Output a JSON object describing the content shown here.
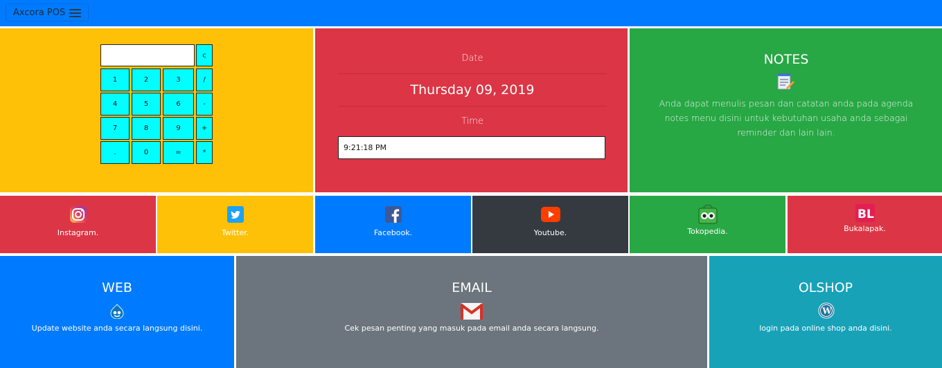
{
  "navbar": {
    "brand": "Axcora POS"
  },
  "calculator": {
    "display_value": "",
    "keys": [
      "c",
      "1",
      "2",
      "3",
      "/",
      "4",
      "5",
      "6",
      "-",
      "7",
      "8",
      "9",
      "+",
      ".",
      "0",
      "=",
      "*"
    ]
  },
  "datetime": {
    "date_label": "Date",
    "date_value": "Thursday 09, 2019",
    "time_label": "Time",
    "time_value": "9:21:18 PM"
  },
  "notes": {
    "title": "NOTES",
    "description": "Anda dapat menulis pesan dan catatan anda pada agenda notes menu disini untuk kebutuhan usaha anda sebagai reminder dan lain lain."
  },
  "social": [
    {
      "label": "Instagram.",
      "icon": "instagram-icon"
    },
    {
      "label": "Twitter.",
      "icon": "twitter-icon"
    },
    {
      "label": "Facebook.",
      "icon": "facebook-icon"
    },
    {
      "label": "Youtube.",
      "icon": "youtube-icon"
    },
    {
      "label": "Tokopedia.",
      "icon": "tokopedia-icon"
    },
    {
      "label": "Bukalapak.",
      "icon": "bukalapak-icon"
    }
  ],
  "panels": {
    "web": {
      "title": "WEB",
      "text": "Update website anda secara langsung disini.",
      "icon": "drupal-icon"
    },
    "email": {
      "title": "EMAIL",
      "text": "Cek pesan penting yang masuk pada email anda secara langsung.",
      "icon": "gmail-icon"
    },
    "olshop": {
      "title": "OLSHOP",
      "text": "login pada online shop anda disini.",
      "icon": "wordpress-icon"
    }
  },
  "colors": {
    "primary": "#007bff",
    "warning": "#ffc107",
    "danger": "#dc3545",
    "success": "#28a745",
    "dark": "#343a40",
    "secondary": "#6c757d",
    "info": "#17a2b8",
    "calc_key": "#00ffff"
  }
}
